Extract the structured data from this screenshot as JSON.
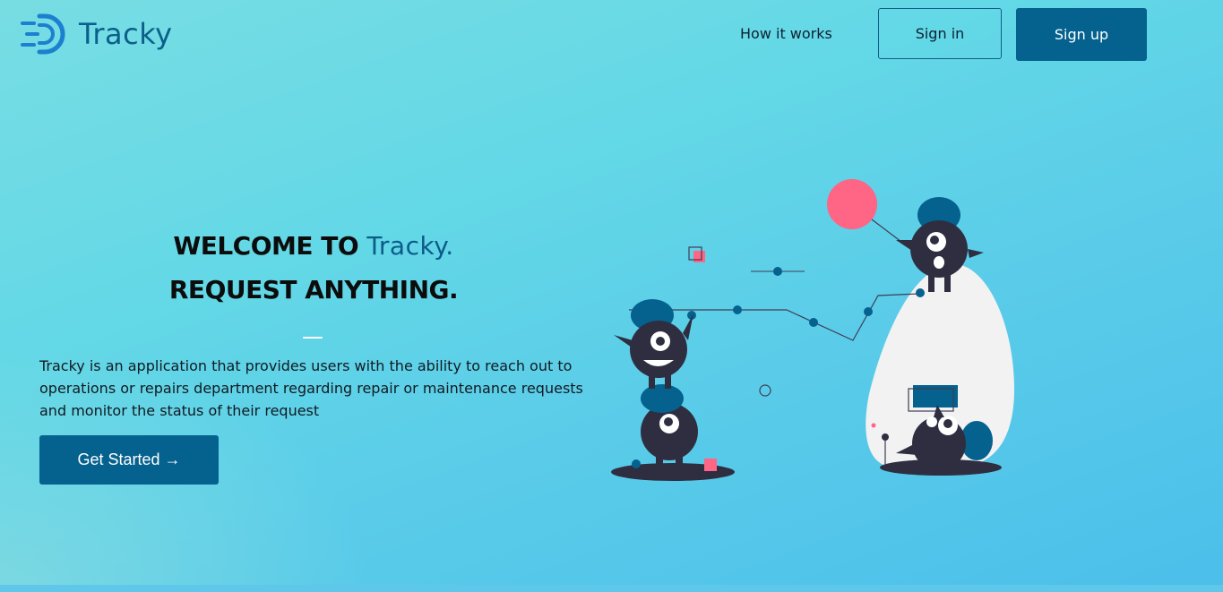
{
  "brand": {
    "name": "Tracky",
    "logo_icon": "tracky-logo-icon"
  },
  "nav": {
    "how_it_works": "How it works",
    "sign_in": "Sign in",
    "sign_up": "Sign up"
  },
  "hero": {
    "welcome_prefix": "WELCOME TO ",
    "welcome_brand": "Tracky.",
    "subtitle": "REQUEST ANYTHING.",
    "description": "Tracky is an application that provides users with the ability to reach out to operations or repairs department regarding repair or maintenance requests and monitor the status of their request",
    "cta_label": "Get Started →"
  },
  "colors": {
    "primary": "#05618e",
    "brand_text": "#0b5f8a",
    "accent_pink": "#ff6584",
    "monster_dark": "#2f2e41",
    "blob_light": "#f2f2f2"
  }
}
